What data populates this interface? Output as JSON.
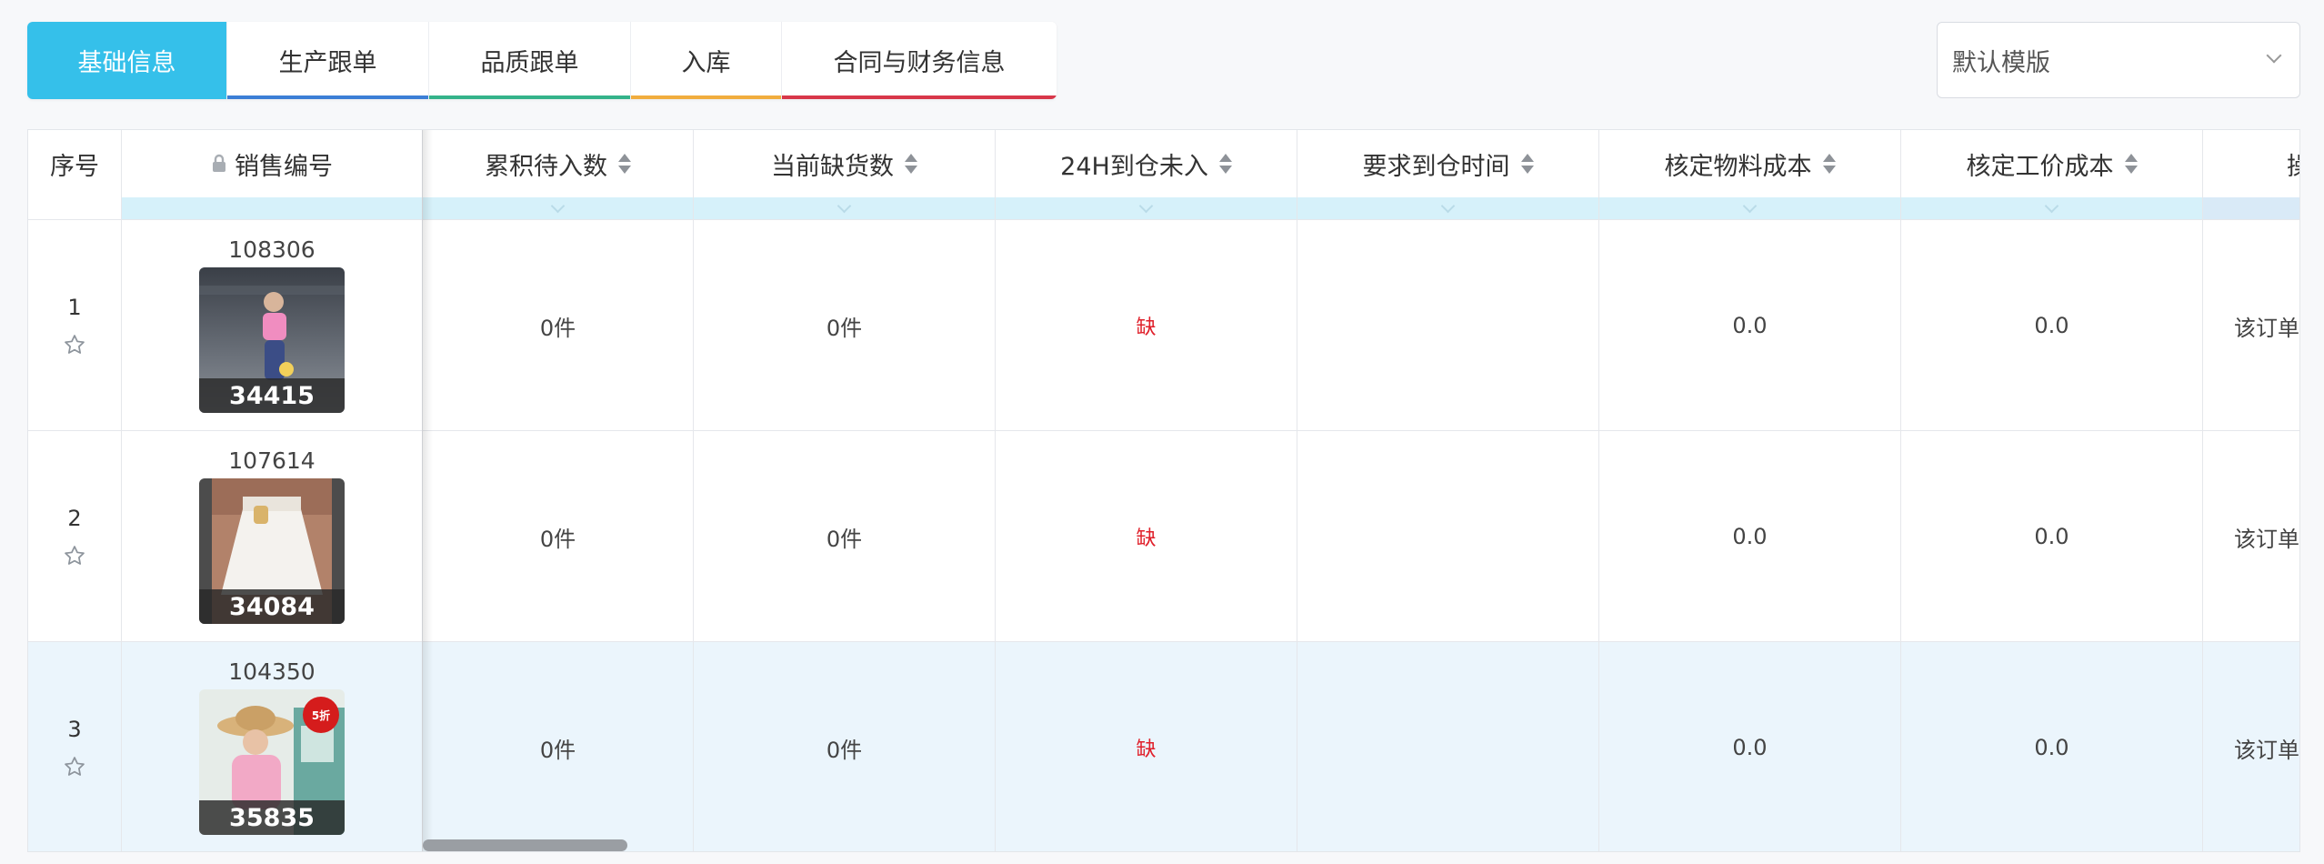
{
  "tabs": [
    {
      "label": "基础信息",
      "active": true,
      "color": "#35c0ea"
    },
    {
      "label": "生产跟单",
      "active": false,
      "color": "#3c7fd6"
    },
    {
      "label": "品质跟单",
      "active": false,
      "color": "#34b38a"
    },
    {
      "label": "入库",
      "active": false,
      "color": "#f1ad3e"
    },
    {
      "label": "合同与财务信息",
      "active": false,
      "color": "#d8374a"
    }
  ],
  "template_select": {
    "value": "默认模版"
  },
  "table": {
    "columns": {
      "index": "序号",
      "sale_no": "销售编号",
      "pending_in": "累积待入数",
      "current_short": "当前缺货数",
      "h24_not_in": "24H到仓未入",
      "required_time": "要求到仓时间",
      "material_cost": "核定物料成本",
      "labor_cost": "核定工价成本",
      "cut_col": "操"
    },
    "rows": [
      {
        "index": "1",
        "sale_no": "108306",
        "product_code": "34415",
        "pending_in": "0件",
        "current_short": "0件",
        "h24_not_in": "缺",
        "required_time": "",
        "material_cost": "0.0",
        "labor_cost": "0.0",
        "note": "该订单",
        "highlighted": false
      },
      {
        "index": "2",
        "sale_no": "107614",
        "product_code": "34084",
        "pending_in": "0件",
        "current_short": "0件",
        "h24_not_in": "缺",
        "required_time": "",
        "material_cost": "0.0",
        "labor_cost": "0.0",
        "note": "该订单",
        "highlighted": false
      },
      {
        "index": "3",
        "sale_no": "104350",
        "product_code": "35835",
        "pending_in": "0件",
        "current_short": "0件",
        "h24_not_in": "缺",
        "required_time": "",
        "material_cost": "0.0",
        "labor_cost": "0.0",
        "note": "该订单",
        "highlighted": true,
        "badge": "5折"
      }
    ]
  },
  "colors": {
    "accent": "#35c0ea",
    "shortage": "#e0202b",
    "highlight_row": "#ebf5fc",
    "filter_bar": "#d6f1fa"
  }
}
